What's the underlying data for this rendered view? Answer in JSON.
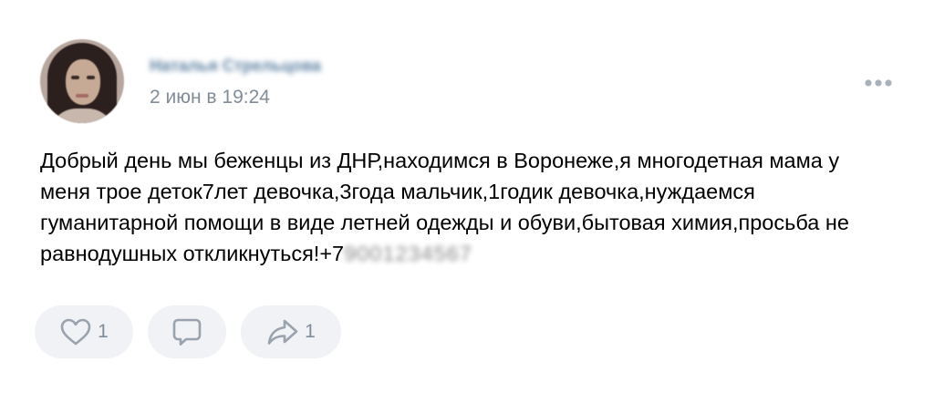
{
  "post": {
    "author_name": "Наталья Стрельцова",
    "date": "2 июн в 19:24",
    "text_lines": [
      "Добрый день мы беженцы из ДНР,находимся в Воронеже,я многодетная мама у",
      "меня трое деток7лет девочка,3года мальчик,1годик девочка,нуждаемся",
      "гуманитарной помощи в виде летней одежды и обуви,бытовая химия,просьба не",
      "равнодушных откликнуться!+7"
    ],
    "phone_hidden": "9001234567",
    "more_icon": "more-horizontal-icon"
  },
  "actions": {
    "like": {
      "icon": "heart-icon",
      "count": "1"
    },
    "comment": {
      "icon": "comment-icon"
    },
    "share": {
      "icon": "share-arrow-icon",
      "count": "1"
    }
  },
  "colors": {
    "author_link": "#2a5885",
    "secondary_text": "#818c99",
    "button_bg": "#f0f2f5",
    "icon": "#99a2ad",
    "text": "#000000"
  }
}
